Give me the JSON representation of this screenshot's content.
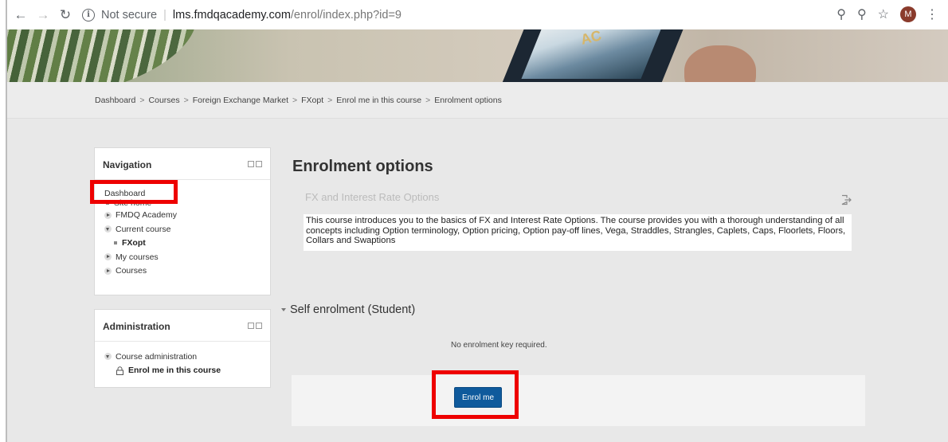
{
  "browser": {
    "security_label": "Not secure",
    "url_host": "lms.fmdqacademy.com",
    "url_path": "/enrol/index.php?id=9",
    "profile_initial": "M"
  },
  "banner": {
    "logo_text": "AC"
  },
  "breadcrumb": [
    "Dashboard",
    "Courses",
    "Foreign Exchange Market",
    "FXopt",
    "Enrol me in this course",
    "Enrolment options"
  ],
  "navigation": {
    "title": "Navigation",
    "items": [
      {
        "label": "Dashboard"
      },
      {
        "label": "Site home"
      },
      {
        "label": "FMDQ Academy"
      },
      {
        "label": "Current course"
      },
      {
        "label": "FXopt"
      },
      {
        "label": "My courses"
      },
      {
        "label": "Courses"
      }
    ]
  },
  "administration": {
    "title": "Administration",
    "items": [
      {
        "label": "Course administration"
      },
      {
        "label": "Enrol me in this course"
      }
    ]
  },
  "main": {
    "title": "Enrolment options",
    "course_name": "FX and Interest Rate Options",
    "summary": "This course introduces you to the basics of FX and Interest Rate Options. The course provides you with a thorough understanding of all concepts including Option terminology, Option pricing, Option pay-off lines, Vega, Straddles, Strangles, Caplets, Caps, Floorlets, Floors, Collars and Swaptions",
    "section_title": "Self enrolment (Student)",
    "no_key_text": "No enrolment key required.",
    "enrol_button": "Enrol me"
  },
  "colors": {
    "highlight": "#ee0000",
    "button": "#0f5a9c"
  }
}
